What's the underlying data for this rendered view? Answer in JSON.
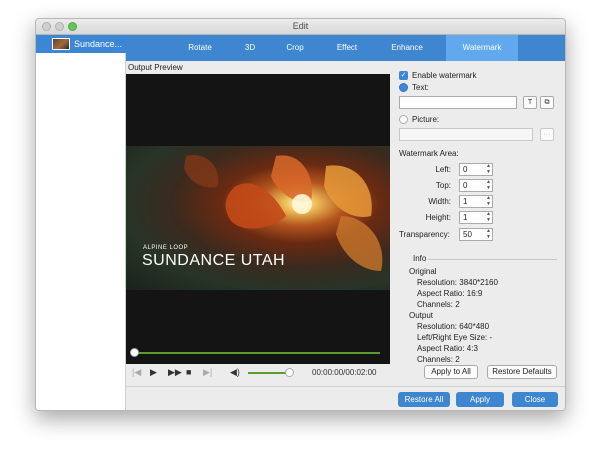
{
  "window": {
    "title": "Edit"
  },
  "sidebar": {
    "items": [
      {
        "label": "Sundance..."
      }
    ]
  },
  "tabs": [
    {
      "label": "Rotate",
      "active": false
    },
    {
      "label": "3D",
      "active": false
    },
    {
      "label": "Crop",
      "active": false
    },
    {
      "label": "Effect",
      "active": false
    },
    {
      "label": "Enhance",
      "active": false
    },
    {
      "label": "Watermark",
      "active": true
    }
  ],
  "preview": {
    "label": "Output Preview",
    "frame_subtitle": "ALPINE LOOP",
    "frame_title": "SUNDANCE UTAH",
    "progress": 0,
    "volume": 1.0,
    "time": "00:00:00/00:02:00"
  },
  "watermark": {
    "enable_label": "Enable watermark",
    "enabled": true,
    "text_label": "Text:",
    "text_value": "",
    "picture_label": "Picture:",
    "picture_value": "",
    "text_mode": "text",
    "area_label": "Watermark Area:",
    "left_label": "Left:",
    "left_value": "0",
    "top_label": "Top:",
    "top_value": "0",
    "width_label": "Width:",
    "width_value": "1",
    "height_label": "Height:",
    "height_value": "1",
    "transparency_label": "Transparency:",
    "transparency_value": "50",
    "text_font_glyph": "T",
    "browse_label": "···"
  },
  "info": {
    "title": "Info",
    "original_title": "Original",
    "original_resolution": "Resolution: 3840*2160",
    "original_aspect": "Aspect Ratio: 16:9",
    "original_channels": "Channels: 2",
    "output_title": "Output",
    "output_resolution": "Resolution: 640*480",
    "output_eye": "Left/Right Eye Size: -",
    "output_aspect": "Aspect Ratio: 4:3",
    "output_channels": "Channels: 2"
  },
  "buttons": {
    "apply_to_all": "Apply to All",
    "restore_defaults": "Restore Defaults",
    "restore_all": "Restore All",
    "apply": "Apply",
    "close": "Close"
  },
  "colors": {
    "accent": "#3e86cf",
    "active_tab": "#61a8ee",
    "progress": "#5a9d2c"
  }
}
